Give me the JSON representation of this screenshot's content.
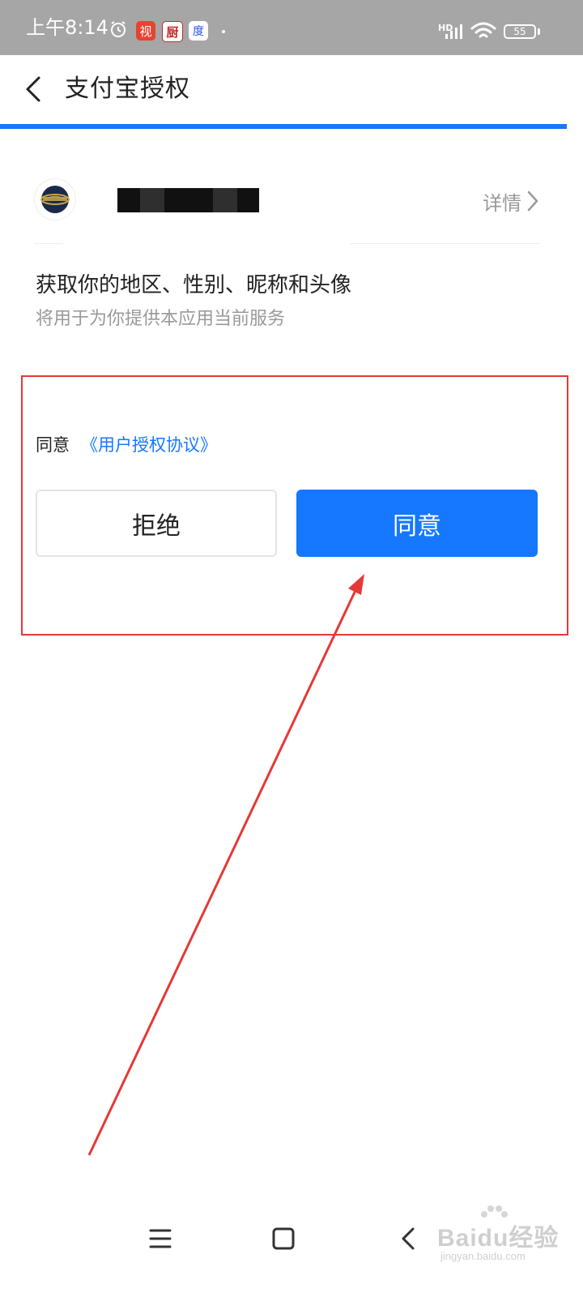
{
  "status_bar": {
    "time": "上午8:14",
    "app_icons": [
      "视",
      "厨",
      "度"
    ],
    "network_label": "HD",
    "battery_level": "55"
  },
  "header": {
    "title": "支付宝授权"
  },
  "app_info": {
    "detail_label": "详情"
  },
  "permission": {
    "title": "获取你的地区、性别、昵称和头像",
    "subtitle": "将用于为你提供本应用当前服务"
  },
  "agreement": {
    "prefix": "同意",
    "link_text": "《用户授权协议》"
  },
  "buttons": {
    "reject": "拒绝",
    "agree": "同意"
  },
  "watermark": {
    "main": "Baidu经验",
    "sub": "jingyan.baidu.com"
  },
  "colors": {
    "accent": "#1677ff",
    "highlight": "#e53935",
    "status_bar": "#a6a6a6"
  }
}
